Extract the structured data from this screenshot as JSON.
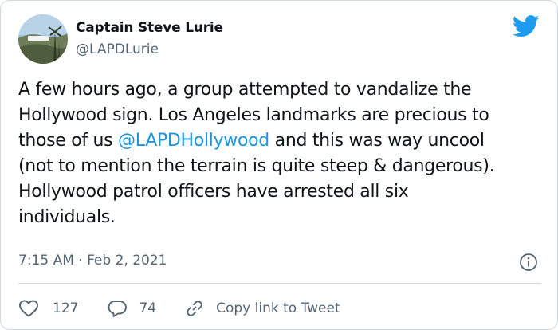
{
  "tweet": {
    "author_name": "Captain Steve Lurie",
    "author_handle": "@LAPDLurie",
    "text_before": "A few hours ago, a group attempted to vandalize the\nHollywood sign. Los Angeles landmarks are precious to\nthose of us ",
    "mention": "@LAPDHollywood",
    "text_after": " and this was way uncool\n(not to mention the terrain is quite steep & dangerous).\nHollywood patrol officers have arrested all six\nindividuals.",
    "timestamp": "7:15 AM · Feb 2, 2021",
    "like_count": "127",
    "reply_count": "74",
    "copy_link_label": "Copy link to Tweet"
  },
  "icons": {
    "brand": "twitter-bird-icon",
    "info": "info-icon",
    "like": "heart-icon",
    "reply": "speech-bubble-icon",
    "copy": "link-icon"
  },
  "colors": {
    "brand_blue": "#1d9bf0",
    "mention_blue": "#1b95e0",
    "secondary_text": "#536471"
  }
}
